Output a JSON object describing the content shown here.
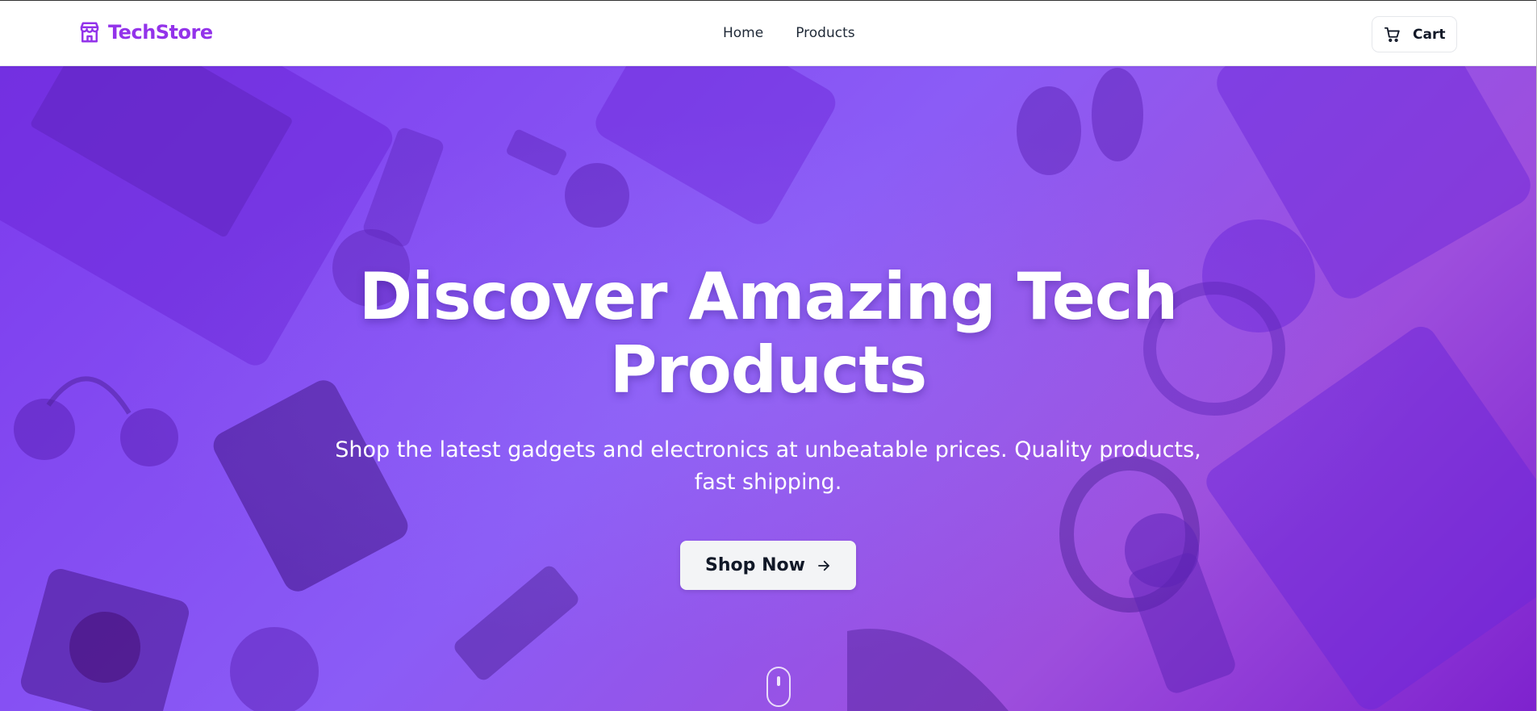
{
  "brand": {
    "name": "TechStore",
    "color": "#9333ea",
    "icon": "store-icon"
  },
  "nav": {
    "items": [
      {
        "label": "Home"
      },
      {
        "label": "Products"
      }
    ]
  },
  "cart": {
    "label": "Cart",
    "icon": "shopping-cart-icon"
  },
  "hero": {
    "title_line1": "Discover Amazing Tech",
    "title_line2": "Products",
    "subtitle": "Shop the latest gadgets and electronics at unbeatable prices. Quality products, fast shipping.",
    "cta_label": "Shop Now",
    "cta_icon": "arrow-right-icon",
    "background_color": "#8b5cf6",
    "scroll_icon": "mouse-scroll-icon"
  }
}
